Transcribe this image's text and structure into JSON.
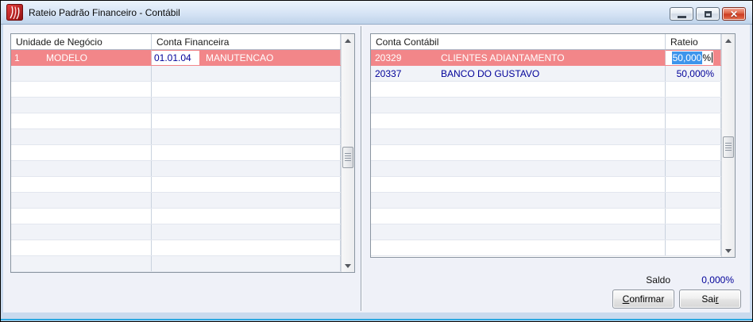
{
  "titlebar": {
    "title": "Rateio Padrão Financeiro - Contábil"
  },
  "icons": {
    "app_icon": "red-swirl-logo",
    "minimize": "minimize-bar",
    "maximize": "restore-square",
    "close_glyph": "✕"
  },
  "left_grid": {
    "headers": {
      "col1": "Unidade de Negócio",
      "col2": "Conta Financeira"
    },
    "row1": {
      "unit_code": "1",
      "unit_name": "MODELO",
      "account_code": "01.01.04",
      "account_name": "MANUTENCAO"
    },
    "empty_rows": 13
  },
  "right_grid": {
    "headers": {
      "col1": "Conta Contábil",
      "col2": "Rateio"
    },
    "row1": {
      "code": "20329",
      "name": "CLIENTES ADIANTAMENTO",
      "rateio_selected": "50,000",
      "rateio_suffix": "%"
    },
    "row2": {
      "code": "20337",
      "name": "BANCO DO GUSTAVO",
      "rateio": "50,000%"
    },
    "empty_rows": 11
  },
  "footer": {
    "saldo_label": "Saldo",
    "saldo_value": "0,000%",
    "confirm_key": "C",
    "confirm_rest": "onfirmar",
    "exit_pre": "Sai",
    "exit_key": "r"
  },
  "colors": {
    "selected_row": "#F28689",
    "selection_highlight": "#3D95EC",
    "grid_value_text": "#000099",
    "frame_blue": "#C9DAEE",
    "frame_accent_cyan": "#2BA7E0",
    "close_button_red": "#CD3D22",
    "app_icon_red": "#C41414"
  }
}
